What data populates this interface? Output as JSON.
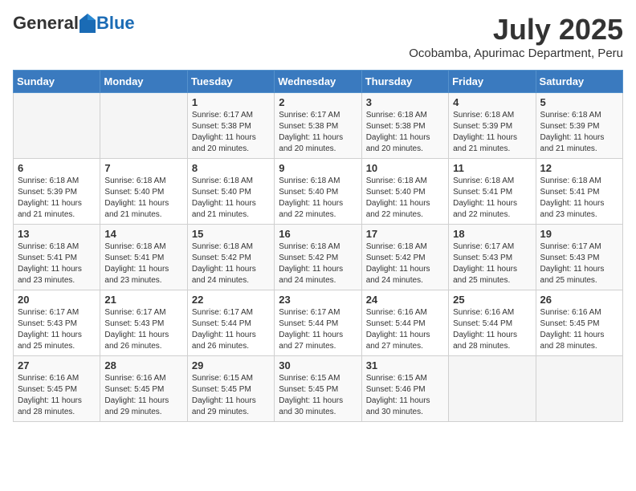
{
  "logo": {
    "general": "General",
    "blue": "Blue"
  },
  "title": {
    "month_year": "July 2025",
    "location": "Ocobamba, Apurimac Department, Peru"
  },
  "headers": [
    "Sunday",
    "Monday",
    "Tuesday",
    "Wednesday",
    "Thursday",
    "Friday",
    "Saturday"
  ],
  "weeks": [
    [
      {
        "day": "",
        "info": ""
      },
      {
        "day": "",
        "info": ""
      },
      {
        "day": "1",
        "info": "Sunrise: 6:17 AM\nSunset: 5:38 PM\nDaylight: 11 hours and 20 minutes."
      },
      {
        "day": "2",
        "info": "Sunrise: 6:17 AM\nSunset: 5:38 PM\nDaylight: 11 hours and 20 minutes."
      },
      {
        "day": "3",
        "info": "Sunrise: 6:18 AM\nSunset: 5:38 PM\nDaylight: 11 hours and 20 minutes."
      },
      {
        "day": "4",
        "info": "Sunrise: 6:18 AM\nSunset: 5:39 PM\nDaylight: 11 hours and 21 minutes."
      },
      {
        "day": "5",
        "info": "Sunrise: 6:18 AM\nSunset: 5:39 PM\nDaylight: 11 hours and 21 minutes."
      }
    ],
    [
      {
        "day": "6",
        "info": "Sunrise: 6:18 AM\nSunset: 5:39 PM\nDaylight: 11 hours and 21 minutes."
      },
      {
        "day": "7",
        "info": "Sunrise: 6:18 AM\nSunset: 5:40 PM\nDaylight: 11 hours and 21 minutes."
      },
      {
        "day": "8",
        "info": "Sunrise: 6:18 AM\nSunset: 5:40 PM\nDaylight: 11 hours and 21 minutes."
      },
      {
        "day": "9",
        "info": "Sunrise: 6:18 AM\nSunset: 5:40 PM\nDaylight: 11 hours and 22 minutes."
      },
      {
        "day": "10",
        "info": "Sunrise: 6:18 AM\nSunset: 5:40 PM\nDaylight: 11 hours and 22 minutes."
      },
      {
        "day": "11",
        "info": "Sunrise: 6:18 AM\nSunset: 5:41 PM\nDaylight: 11 hours and 22 minutes."
      },
      {
        "day": "12",
        "info": "Sunrise: 6:18 AM\nSunset: 5:41 PM\nDaylight: 11 hours and 23 minutes."
      }
    ],
    [
      {
        "day": "13",
        "info": "Sunrise: 6:18 AM\nSunset: 5:41 PM\nDaylight: 11 hours and 23 minutes."
      },
      {
        "day": "14",
        "info": "Sunrise: 6:18 AM\nSunset: 5:41 PM\nDaylight: 11 hours and 23 minutes."
      },
      {
        "day": "15",
        "info": "Sunrise: 6:18 AM\nSunset: 5:42 PM\nDaylight: 11 hours and 24 minutes."
      },
      {
        "day": "16",
        "info": "Sunrise: 6:18 AM\nSunset: 5:42 PM\nDaylight: 11 hours and 24 minutes."
      },
      {
        "day": "17",
        "info": "Sunrise: 6:18 AM\nSunset: 5:42 PM\nDaylight: 11 hours and 24 minutes."
      },
      {
        "day": "18",
        "info": "Sunrise: 6:17 AM\nSunset: 5:43 PM\nDaylight: 11 hours and 25 minutes."
      },
      {
        "day": "19",
        "info": "Sunrise: 6:17 AM\nSunset: 5:43 PM\nDaylight: 11 hours and 25 minutes."
      }
    ],
    [
      {
        "day": "20",
        "info": "Sunrise: 6:17 AM\nSunset: 5:43 PM\nDaylight: 11 hours and 25 minutes."
      },
      {
        "day": "21",
        "info": "Sunrise: 6:17 AM\nSunset: 5:43 PM\nDaylight: 11 hours and 26 minutes."
      },
      {
        "day": "22",
        "info": "Sunrise: 6:17 AM\nSunset: 5:44 PM\nDaylight: 11 hours and 26 minutes."
      },
      {
        "day": "23",
        "info": "Sunrise: 6:17 AM\nSunset: 5:44 PM\nDaylight: 11 hours and 27 minutes."
      },
      {
        "day": "24",
        "info": "Sunrise: 6:16 AM\nSunset: 5:44 PM\nDaylight: 11 hours and 27 minutes."
      },
      {
        "day": "25",
        "info": "Sunrise: 6:16 AM\nSunset: 5:44 PM\nDaylight: 11 hours and 28 minutes."
      },
      {
        "day": "26",
        "info": "Sunrise: 6:16 AM\nSunset: 5:45 PM\nDaylight: 11 hours and 28 minutes."
      }
    ],
    [
      {
        "day": "27",
        "info": "Sunrise: 6:16 AM\nSunset: 5:45 PM\nDaylight: 11 hours and 28 minutes."
      },
      {
        "day": "28",
        "info": "Sunrise: 6:16 AM\nSunset: 5:45 PM\nDaylight: 11 hours and 29 minutes."
      },
      {
        "day": "29",
        "info": "Sunrise: 6:15 AM\nSunset: 5:45 PM\nDaylight: 11 hours and 29 minutes."
      },
      {
        "day": "30",
        "info": "Sunrise: 6:15 AM\nSunset: 5:45 PM\nDaylight: 11 hours and 30 minutes."
      },
      {
        "day": "31",
        "info": "Sunrise: 6:15 AM\nSunset: 5:46 PM\nDaylight: 11 hours and 30 minutes."
      },
      {
        "day": "",
        "info": ""
      },
      {
        "day": "",
        "info": ""
      }
    ]
  ]
}
